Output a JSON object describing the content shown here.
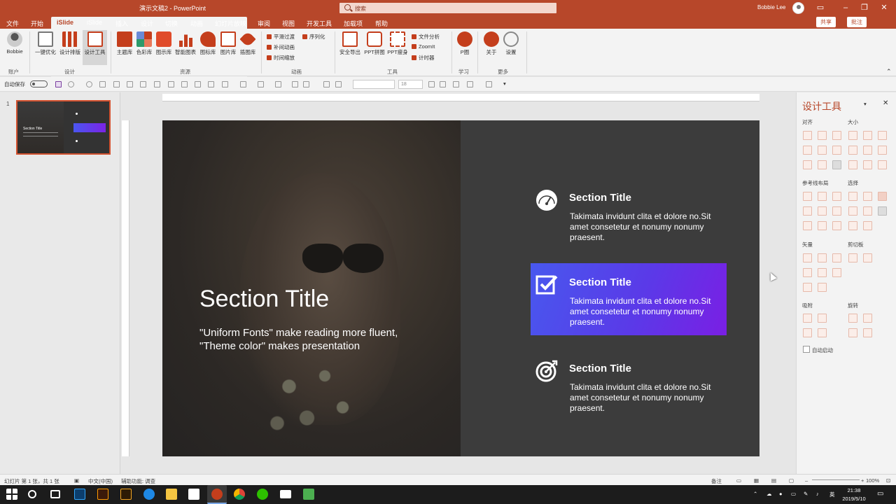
{
  "window": {
    "doc_title": "演示文稿2 - PowerPoint",
    "search_placeholder": "搜索",
    "user": "Bobbie Lee"
  },
  "menu": {
    "items": [
      "文件",
      "开始",
      "iSlide",
      "iSlide",
      "插入",
      "设计",
      "切换",
      "动画",
      "幻灯片放映",
      "审阅",
      "视图",
      "开发工具",
      "加载项",
      "帮助"
    ],
    "active_index": 2,
    "share": "共享",
    "comment": "批注"
  },
  "ribbon": {
    "account": {
      "label": "Bobbie",
      "group": "账户"
    },
    "design": {
      "buttons": [
        "一键优化",
        "设计排版",
        "设计工具"
      ],
      "group": "设计"
    },
    "resources": {
      "buttons": [
        "主题库",
        "色彩库",
        "图示库",
        "智能图表",
        "图标库",
        "图片库",
        "插图库"
      ],
      "group": "资源"
    },
    "animation": {
      "items": [
        "平滑过渡",
        "补间动画",
        "时间缩放",
        "序列化"
      ],
      "group": "动画"
    },
    "tools": {
      "buttons": [
        "安全导出",
        "PPT拼图",
        "PPT瘦身"
      ],
      "items": [
        "文件分析",
        "ZoomIt",
        "计时器"
      ],
      "group": "工具"
    },
    "learn": {
      "buttons": [
        "P圈"
      ],
      "group": "学习"
    },
    "more": {
      "buttons": [
        "关于",
        "设置"
      ],
      "group": "更多"
    }
  },
  "qat": {
    "autosave": "自动保存",
    "font_size": "18"
  },
  "thumbs": {
    "number": "1"
  },
  "slide": {
    "title": "Section Title",
    "subtitle": "\"Uniform Fonts\" make reading more fluent, \"Theme color\" makes presentation",
    "items": [
      {
        "title": "Section Title",
        "text": "Takimata invidunt clita et dolore no.Sit amet consetetur et nonumy nonumy praesent.",
        "icon": "speedometer-icon"
      },
      {
        "title": "Section Title",
        "text": "Takimata invidunt clita et dolore no.Sit amet consetetur et nonumy nonumy praesent.",
        "icon": "checkbox-icon"
      },
      {
        "title": "Section Title",
        "text": "Takimata invidunt clita et dolore no.Sit amet consetetur et nonumy nonumy praesent.",
        "icon": "target-icon"
      }
    ],
    "highlight_colors": [
      "#4858ee",
      "#7a1fe4"
    ]
  },
  "panel": {
    "title": "设计工具",
    "sections": [
      "对齐",
      "大小",
      "参考线布局",
      "选择",
      "矢量",
      "剪切板",
      "吸附",
      "旋转"
    ],
    "checkbox": "自动启动"
  },
  "status": {
    "slide_info": "幻灯片 第 1 张，共 1 张",
    "language": "中文(中国)",
    "accessibility": "辅助功能: 调查",
    "notes": "备注",
    "zoom": "100%"
  },
  "taskbar": {
    "time": "21:38",
    "date": "2019/5/10",
    "ime": "英"
  },
  "colors": {
    "accent": "#b7472a",
    "slide_bg": "#3c3c3c"
  }
}
